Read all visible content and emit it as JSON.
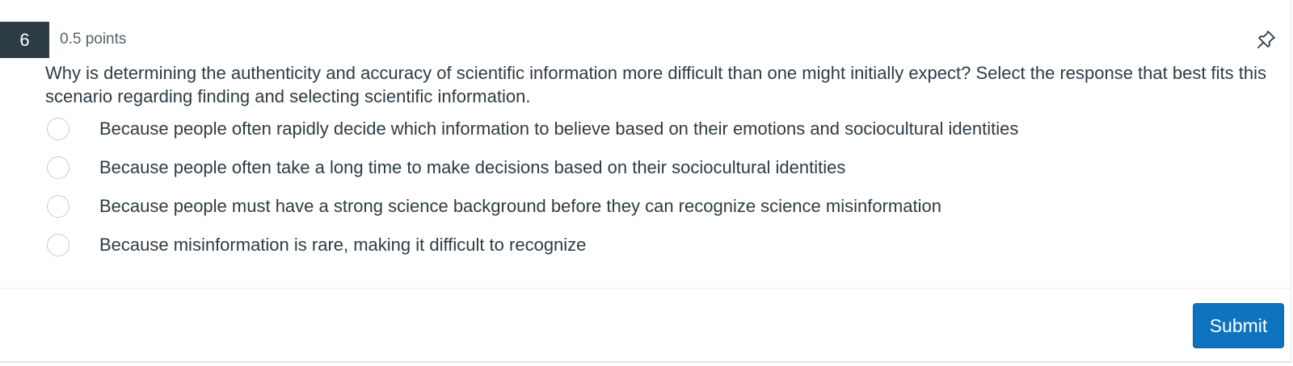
{
  "question": {
    "number": "6",
    "points": "0.5 points",
    "text": "Why is determining the authenticity and accuracy of scientific information more difficult than one might initially expect? Select the response that best fits this scenario regarding finding and selecting scientific information."
  },
  "answers": [
    {
      "label": "Because people often rapidly decide which information to believe based on their emotions and sociocultural identities",
      "selected": false
    },
    {
      "label": "Because people often take a long time to make decisions based on their sociocultural identities",
      "selected": false
    },
    {
      "label": "Because people must have a strong science background before they can recognize science misinformation",
      "selected": false
    },
    {
      "label": "Because misinformation is rare, making it difficult to recognize",
      "selected": false
    }
  ],
  "footer": {
    "submit_label": "Submit"
  },
  "icons": {
    "pin": "pin-icon"
  },
  "colors": {
    "number_badge_bg": "#2d3b45",
    "submit_bg": "#0d73bf",
    "text": "#2d3b45"
  }
}
